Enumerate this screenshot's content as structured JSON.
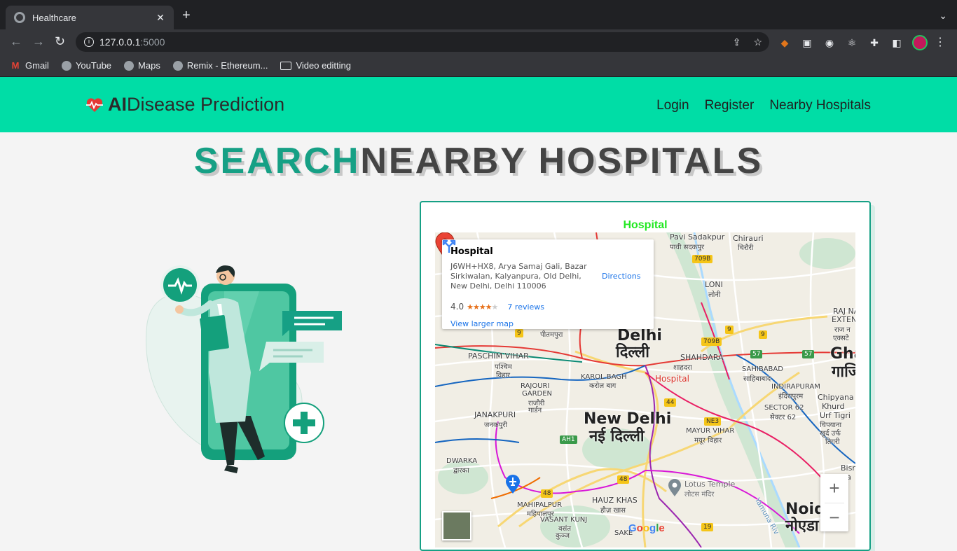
{
  "browser": {
    "tab_title": "Healthcare",
    "url_host": "127.0.0.1",
    "url_port": ":5000",
    "bookmarks": [
      "Gmail",
      "YouTube",
      "Maps",
      "Remix - Ethereum...",
      "Video editting"
    ]
  },
  "header": {
    "brand_ai": "AI",
    "brand_rest": "Disease Prediction",
    "nav": [
      "Login",
      "Register",
      "Nearby Hospitals"
    ]
  },
  "hero": {
    "title_highlight": "SEARCH",
    "title_rest": "NEARBY HOSPITALS"
  },
  "map_section": {
    "heading": "Hospital",
    "info_card": {
      "title": "Hospital",
      "address": "J6WH+HX8, Arya Samaj Gali, Bazar Sirkiwalan, Kalyanpura, Old Delhi, New Delhi, Delhi 110006",
      "rating": "4.0",
      "stars": 4,
      "reviews": "7 reviews",
      "larger_map": "View larger map",
      "directions": "Directions"
    },
    "marker_label": "Hospital",
    "labels": {
      "pavi1": "Pavi Sadakpur",
      "pavi2": "पावी सदकपुर",
      "chirauri1": "Chirauri",
      "chirauri2": "चिरौरी",
      "loni1": "LONI",
      "loni2": "लोनी",
      "raj1": "RAJ NA",
      "raj2": "EXTENS",
      "raj3": "राज न",
      "raj4": "एक्सटे",
      "pitampura": "पीतमपुरा",
      "delhi1": "Delhi",
      "delhi2": "दिल्ली",
      "shahdara1": "SHAHDARA",
      "shahdara2": "शाहदरा",
      "sahibabad1": "SAHIBABAD",
      "sahibabad2": "साहिबाबाद",
      "gha1": "Gha",
      "gha2": "गाजि",
      "paschim1": "PASCHIM VIHAR",
      "paschim2": "पश्चिम",
      "paschim3": "विहार",
      "karol1": "KAROL BAGH",
      "karol2": "करोल बाग",
      "rajouri1": "RAJOURI",
      "rajouri2": "GARDEN",
      "rajouri3": "राजौरी",
      "rajouri4": "गार्डन",
      "indirapuram1": "INDIRAPURAM",
      "indirapuram2": "इंदिरापुरम",
      "sector1": "SECTOR 62",
      "sector2": "सेक्टर 62",
      "chipyana1": "Chipyana",
      "chipyana2": "Khurd",
      "chipyana3": "Urf Tigri",
      "chipyana4": "चिपयाना",
      "chipyana5": "खुर्द उर्फ",
      "chipyana6": "तिगरी",
      "janakpuri1": "JANAKPURI",
      "janakpuri2": "जनकपुरी",
      "newdelhi1": "New Delhi",
      "newdelhi2": "नई दिल्ली",
      "mayur1": "MAYUR VIHAR",
      "mayur2": "मयूर विहार",
      "dwarka1": "DWARKA",
      "dwarka2": "द्वारका",
      "lotus1": "Lotus Temple",
      "lotus2": "लोटस मंदिर",
      "bisra1": "Bisra",
      "bisra2": "Ia",
      "mahipalpur1": "MAHIPALPUR",
      "mahipalpur2": "महिपालपुर",
      "hauz1": "HAUZ KHAS",
      "hauz2": "हौज़ खास",
      "vasant1": "VASANT KUNJ",
      "vasant2": "वसंत",
      "vasant3": "कुञ्ज",
      "saket": "SAKE",
      "noida1": "Noid",
      "noida2": "नोएडा",
      "yamuna": "Yamuna Riv"
    },
    "shields": [
      "709B",
      "709B",
      "9",
      "9",
      "9",
      "57",
      "57",
      "44",
      "NE3",
      "AH1",
      "48",
      "48",
      "19"
    ],
    "google": "Google",
    "zoom_in": "+",
    "zoom_out": "−"
  }
}
